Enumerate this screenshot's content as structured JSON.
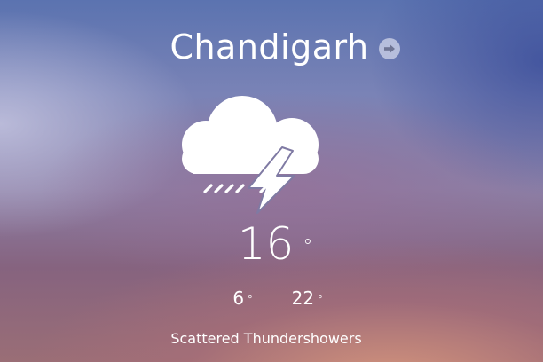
{
  "location": {
    "city": "Chandigarh",
    "next_icon": "arrow-right-circle-icon"
  },
  "weather": {
    "icon": "cloud-rain-lightning-icon",
    "current_temp": "16",
    "degree_symbol": "°",
    "low_temp": "6",
    "high_temp": "22",
    "condition": "Scattered Thundershowers"
  },
  "colors": {
    "text": "#ffffff",
    "arrow_button_bg": "#cdd2e8",
    "arrow_glyph": "#6f7594"
  }
}
